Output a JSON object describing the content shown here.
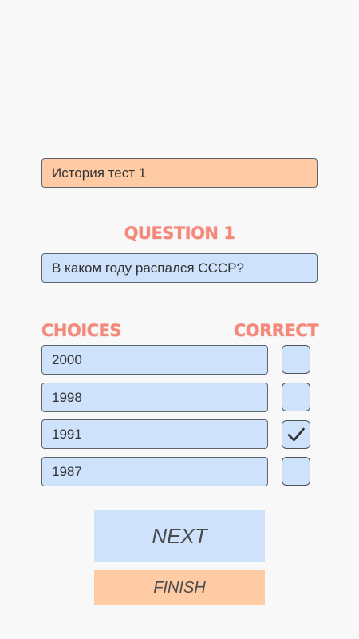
{
  "test_title": "История тест 1",
  "question_heading": "QUESTION 1",
  "question_text": "В каком году распался СССР?",
  "choices_heading": "CHOICES",
  "correct_heading": "CORRECT",
  "choices": [
    {
      "text": "2000",
      "correct": false
    },
    {
      "text": "1998",
      "correct": false
    },
    {
      "text": "1991",
      "correct": true
    },
    {
      "text": "1987",
      "correct": false
    }
  ],
  "buttons": {
    "next": "NEXT",
    "finish": "FINISH"
  },
  "colors": {
    "accent_heading": "#f4897b",
    "input_blue": "#cfe2fc",
    "input_peach": "#ffcba4",
    "background": "#f8f8f8"
  },
  "icons": {
    "checked": "check-icon"
  }
}
